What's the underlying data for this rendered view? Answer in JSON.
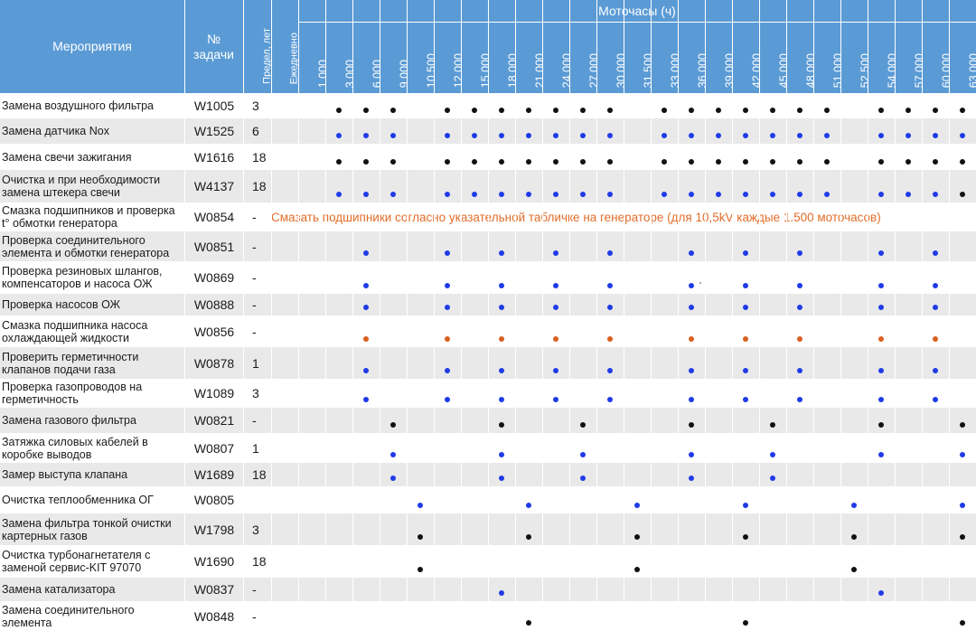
{
  "header": {
    "task_col": "Мероприятия",
    "code_col_1": "№",
    "code_col_2": "задачи",
    "limit_col": "Предел, лет",
    "daily_col": "Ежедневно",
    "hours_group": "Моточасы (ч)"
  },
  "hours": [
    "1.000",
    "3.000",
    "6.000",
    "9.000",
    "10.500",
    "12.000",
    "15.000",
    "18.000",
    "21.000",
    "24.000",
    "27.000",
    "30.000",
    "31.500",
    "33.000",
    "36.000",
    "39.000",
    "42.000",
    "45.000",
    "48.000",
    "51.000",
    "52.500",
    "54.000",
    "57.000",
    "60.000",
    "63.000"
  ],
  "colors": {
    "black": "#111111",
    "blue": "#1f3be8",
    "orange": "#d9601f",
    "header": "#5b9bd5",
    "row_alt": "#e9e9e9",
    "note": "#e26d2a"
  },
  "rows": [
    {
      "task": "Замена воздушного фильтра",
      "code": "W1005",
      "limit": "3",
      "marks": [
        0,
        1,
        1,
        1,
        0,
        1,
        1,
        1,
        1,
        1,
        1,
        1,
        0,
        1,
        1,
        1,
        1,
        1,
        1,
        1,
        0,
        1,
        1,
        1,
        1
      ],
      "color": "black"
    },
    {
      "task": "Замена датчика Nox",
      "code": "W1525",
      "limit": "6",
      "marks": [
        0,
        1,
        1,
        1,
        0,
        1,
        1,
        1,
        1,
        1,
        1,
        1,
        0,
        1,
        1,
        1,
        1,
        1,
        1,
        1,
        0,
        1,
        1,
        1,
        1
      ],
      "color": "blue"
    },
    {
      "task": "Замена свечи зажигания",
      "code": "W1616",
      "limit": "18",
      "marks": [
        0,
        1,
        1,
        1,
        0,
        1,
        1,
        1,
        1,
        1,
        1,
        1,
        0,
        1,
        1,
        1,
        1,
        1,
        1,
        1,
        0,
        1,
        1,
        1,
        1
      ],
      "color": "black"
    },
    {
      "task": "Очистка и при необходимости замена штекера свечи",
      "code": "W4137",
      "limit": "18",
      "marks": [
        0,
        1,
        1,
        1,
        0,
        1,
        1,
        1,
        1,
        1,
        1,
        1,
        0,
        1,
        1,
        1,
        1,
        1,
        1,
        1,
        0,
        1,
        1,
        1,
        1
      ],
      "color": "blue",
      "last_color": "black"
    },
    {
      "task": "Смазка подшипников и проверка t° обмотки генератора",
      "code": "W0854",
      "limit": "-",
      "marks": [
        0,
        0,
        0,
        0,
        0,
        0,
        0,
        0,
        0,
        0,
        0,
        0,
        0,
        0,
        0,
        0,
        0,
        0,
        0,
        0,
        0,
        0,
        0,
        0,
        0
      ],
      "color": "blue",
      "note": "Смазать подшипники согласно указательной табличке на генераторе (для 10,5kV каждые 1.500 моточасов)"
    },
    {
      "task": "Проверка соединительного элемента и обмотки генератора",
      "code": "W0851",
      "limit": "-",
      "marks": [
        0,
        0,
        1,
        0,
        0,
        1,
        0,
        1,
        0,
        1,
        0,
        1,
        0,
        0,
        1,
        0,
        1,
        0,
        1,
        0,
        0,
        1,
        0,
        1,
        0
      ],
      "color": "blue"
    },
    {
      "task": "Проверка резиновых шлангов, компенсаторов и насоса ОЖ",
      "code": "W0869",
      "limit": "-",
      "marks": [
        0,
        0,
        1,
        0,
        0,
        1,
        0,
        1,
        0,
        1,
        0,
        1,
        0,
        0,
        1,
        0,
        1,
        0,
        1,
        0,
        0,
        1,
        0,
        1,
        0
      ],
      "color": "blue"
    },
    {
      "task": "Проверка насосов ОЖ",
      "code": "W0888",
      "limit": "-",
      "marks": [
        0,
        0,
        1,
        0,
        0,
        1,
        0,
        1,
        0,
        1,
        0,
        1,
        0,
        0,
        1,
        0,
        1,
        0,
        1,
        0,
        0,
        1,
        0,
        1,
        0
      ],
      "color": "blue"
    },
    {
      "task": "Смазка подшипника насоса охлаждающей жидкости",
      "code": "W0856",
      "limit": "-",
      "marks": [
        0,
        0,
        1,
        0,
        0,
        1,
        0,
        1,
        0,
        1,
        0,
        1,
        0,
        0,
        1,
        0,
        1,
        0,
        1,
        0,
        0,
        1,
        0,
        1,
        0
      ],
      "color": "orange"
    },
    {
      "task": "Проверить герметичности клапанов подачи газа",
      "code": "W0878",
      "limit": "1",
      "marks": [
        0,
        0,
        1,
        0,
        0,
        1,
        0,
        1,
        0,
        1,
        0,
        1,
        0,
        0,
        1,
        0,
        1,
        0,
        1,
        0,
        0,
        1,
        0,
        1,
        0
      ],
      "color": "blue"
    },
    {
      "task": "Проверка газопроводов на герметичность",
      "code": "W1089",
      "limit": "3",
      "marks": [
        0,
        0,
        1,
        0,
        0,
        1,
        0,
        1,
        0,
        1,
        0,
        1,
        0,
        0,
        1,
        0,
        1,
        0,
        1,
        0,
        0,
        1,
        0,
        1,
        0
      ],
      "color": "blue"
    },
    {
      "task": "Замена газового фильтра",
      "code": "W0821",
      "limit": "-",
      "marks": [
        0,
        0,
        0,
        1,
        0,
        0,
        0,
        1,
        0,
        0,
        1,
        0,
        0,
        0,
        1,
        0,
        0,
        1,
        0,
        0,
        0,
        1,
        0,
        0,
        1
      ],
      "color": "black"
    },
    {
      "task": "Затяжка силовых кабелей в коробке выводов",
      "code": "W0807",
      "limit": "1",
      "marks": [
        0,
        0,
        0,
        1,
        0,
        0,
        0,
        1,
        0,
        0,
        1,
        0,
        0,
        0,
        1,
        0,
        0,
        1,
        0,
        0,
        0,
        1,
        0,
        0,
        1
      ],
      "color": "blue"
    },
    {
      "task": "Замер выступа клапана",
      "code": "W1689",
      "limit": "18",
      "marks": [
        0,
        0,
        0,
        1,
        0,
        0,
        0,
        1,
        0,
        0,
        1,
        0,
        0,
        0,
        1,
        0,
        0,
        1,
        0,
        0,
        0,
        0,
        0,
        0,
        0
      ],
      "color": "blue"
    },
    {
      "task": "Очистка теплообменника ОГ",
      "code": "W0805",
      "limit": "",
      "marks": [
        0,
        0,
        0,
        0,
        1,
        0,
        0,
        0,
        1,
        0,
        0,
        0,
        1,
        0,
        0,
        0,
        1,
        0,
        0,
        0,
        1,
        0,
        0,
        0,
        1
      ],
      "color": "blue"
    },
    {
      "task": "Замена фильтра тонкой очистки картерных газов",
      "code": "W1798",
      "limit": "3",
      "marks": [
        0,
        0,
        0,
        0,
        1,
        0,
        0,
        0,
        1,
        0,
        0,
        0,
        1,
        0,
        0,
        0,
        1,
        0,
        0,
        0,
        1,
        0,
        0,
        0,
        1
      ],
      "color": "black"
    },
    {
      "task": "Очистка турбонагнетателя с заменой сервис-KIT 97070",
      "code": "W1690",
      "limit": "18",
      "marks": [
        0,
        0,
        0,
        0,
        1,
        0,
        0,
        0,
        0,
        0,
        0,
        0,
        1,
        0,
        0,
        0,
        0,
        0,
        0,
        0,
        1,
        0,
        0,
        0,
        0
      ],
      "color": "black"
    },
    {
      "task": "Замена катализатора",
      "code": "W0837",
      "limit": "-",
      "marks": [
        0,
        0,
        0,
        0,
        0,
        0,
        0,
        1,
        0,
        0,
        0,
        0,
        0,
        0,
        0,
        0,
        0,
        0,
        0,
        0,
        0,
        1,
        0,
        0,
        0
      ],
      "color": "blue"
    },
    {
      "task": "Замена соединительного элемента",
      "code": "W0848",
      "limit": "-",
      "marks": [
        0,
        0,
        0,
        0,
        0,
        0,
        0,
        0,
        1,
        0,
        0,
        0,
        0,
        0,
        0,
        0,
        1,
        0,
        0,
        0,
        0,
        0,
        0,
        0,
        1
      ],
      "color": "black"
    }
  ]
}
